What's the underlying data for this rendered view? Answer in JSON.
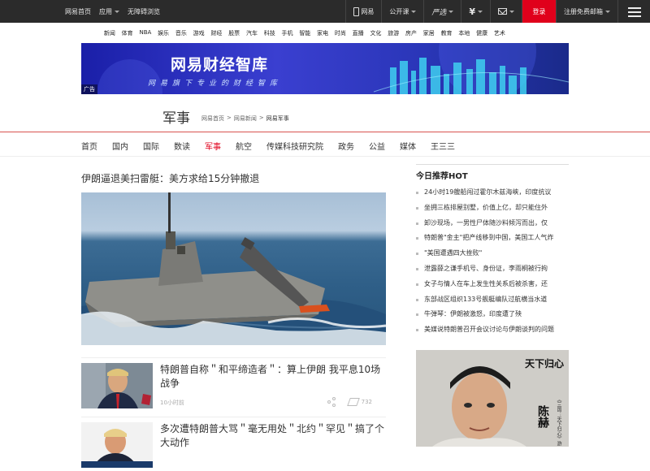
{
  "topbar": {
    "left": {
      "home": "网易首页",
      "apps": "应用",
      "accessible": "无障碍浏览"
    },
    "right": {
      "phone_label": "网易",
      "open_class": "公开课",
      "yanxuan": "严选",
      "login": "登录",
      "register": "注册免费邮箱"
    },
    "login_color": "#e0001b"
  },
  "channels": [
    "新闻",
    "体育",
    "NBA",
    "娱乐",
    "音乐",
    "游戏",
    "财经",
    "股票",
    "汽车",
    "科技",
    "手机",
    "智能",
    "家电",
    "时尚",
    "直播",
    "文化",
    "旅游",
    "房产",
    "家居",
    "教育",
    "本地",
    "健康",
    "艺术"
  ],
  "banner": {
    "title": "网易财经智库",
    "subtitle": "网易旗下专业的财经智库",
    "ad_tag": "广告"
  },
  "section": {
    "title": "军事",
    "breadcrumb": [
      "网易首页",
      "网易新闻",
      "网易军事"
    ]
  },
  "subnav": {
    "items": [
      "首页",
      "国内",
      "国际",
      "数读",
      "军事",
      "航空",
      "传媒科技研究院",
      "政务",
      "公益",
      "媒体",
      "王三三"
    ],
    "active_index": 4,
    "active_color": "#e0001b"
  },
  "main": {
    "headline": "伊朗逼退美扫雷艇：美方求给15分钟撤退",
    "news": [
      {
        "title": "特朗普自称＂和平缔造者＂：算上伊朗 我平息10场战争",
        "time": "10小时前",
        "views": "732"
      },
      {
        "title": "多次遭特朗普大骂＂毫无用处＂北约＂罕见＂搞了个大动作",
        "time": "",
        "views": ""
      }
    ]
  },
  "hot": {
    "title": "今日推荐HOT",
    "items": [
      "24小时19艘船闯过霍尔木兹海峡，印度抗议",
      "坐拥三栋排屋别墅，价值上亿，却只能住外",
      "卸沙现场，一男性尸体随沙料倾泻而出，仅",
      "特朗普\"金主\"把产线移到中国，美国工人气炸",
      "\"美国遭遇四大挫败\"",
      "泄露薛之谦手机号、身份证，李雨桐被行拘",
      "女子与情人在车上发生性关系后被杀害，还",
      "东部战区组织133号舰艇编队过航横当水道",
      "牛弹琴：伊朗被激怒，印度遭了殃",
      "美媒说特朗普召开会议讨论与伊朗谈判的问题"
    ]
  },
  "poster": {
    "title": "天下归心",
    "name": "陈赫",
    "sub": "《三国：天下归心》游戏代言人"
  }
}
